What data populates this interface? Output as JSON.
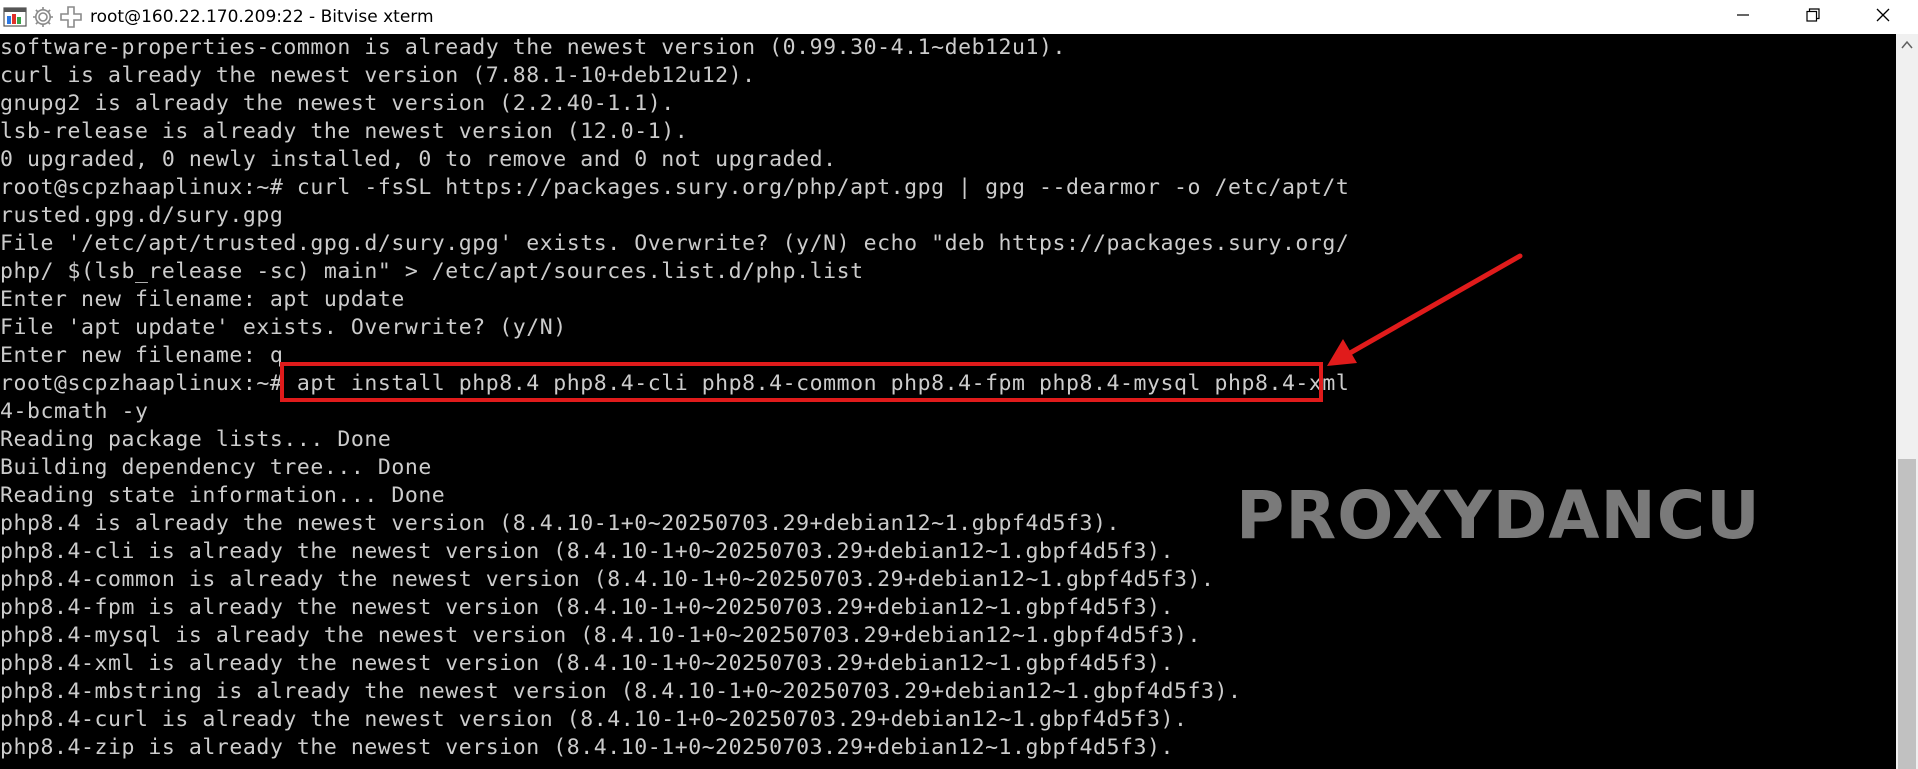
{
  "window": {
    "title": "root@160.22.170.209:22 - Bitvise xterm",
    "icons": [
      "bitvise-app-icon",
      "gear-icon",
      "plus-icon"
    ],
    "controls": [
      "minimize-icon",
      "restore-icon",
      "close-icon"
    ]
  },
  "terminal": {
    "lines": [
      "software-properties-common is already the newest version (0.99.30-4.1~deb12u1).",
      "curl is already the newest version (7.88.1-10+deb12u12).",
      "gnupg2 is already the newest version (2.2.40-1.1).",
      "lsb-release is already the newest version (12.0-1).",
      "0 upgraded, 0 newly installed, 0 to remove and 0 not upgraded.",
      "root@scpzhaaplinux:~# curl -fsSL https://packages.sury.org/php/apt.gpg | gpg --dearmor -o /etc/apt/t",
      "rusted.gpg.d/sury.gpg",
      "File '/etc/apt/trusted.gpg.d/sury.gpg' exists. Overwrite? (y/N) echo \"deb https://packages.sury.org/",
      "php/ $(lsb_release -sc) main\" > /etc/apt/sources.list.d/php.list",
      "Enter new filename: apt update",
      "File 'apt update' exists. Overwrite? (y/N)",
      "Enter new filename: q",
      "root@scpzhaaplinux:~# apt install php8.4 php8.4-cli php8.4-common php8.4-fpm php8.4-mysql php8.4-xml",
      "4-bcmath -y",
      "Reading package lists... Done",
      "Building dependency tree... Done",
      "Reading state information... Done",
      "php8.4 is already the newest version (8.4.10-1+0~20250703.29+debian12~1.gbpf4d5f3).",
      "php8.4-cli is already the newest version (8.4.10-1+0~20250703.29+debian12~1.gbpf4d5f3).",
      "php8.4-common is already the newest version (8.4.10-1+0~20250703.29+debian12~1.gbpf4d5f3).",
      "php8.4-fpm is already the newest version (8.4.10-1+0~20250703.29+debian12~1.gbpf4d5f3).",
      "php8.4-mysql is already the newest version (8.4.10-1+0~20250703.29+debian12~1.gbpf4d5f3).",
      "php8.4-xml is already the newest version (8.4.10-1+0~20250703.29+debian12~1.gbpf4d5f3).",
      "php8.4-mbstring is already the newest version (8.4.10-1+0~20250703.29+debian12~1.gbpf4d5f3).",
      "php8.4-curl is already the newest version (8.4.10-1+0~20250703.29+debian12~1.gbpf4d5f3).",
      "php8.4-zip is already the newest version (8.4.10-1+0~20250703.29+debian12~1.gbpf4d5f3)."
    ],
    "colors": {
      "background": "#000000",
      "text": "#cccccc"
    }
  },
  "annotation": {
    "highlight_color": "#e01b1b",
    "arrow_icon": "red-arrow-icon"
  },
  "watermark": {
    "text": "PROXYDANCU",
    "color": "#7a7a7a"
  }
}
